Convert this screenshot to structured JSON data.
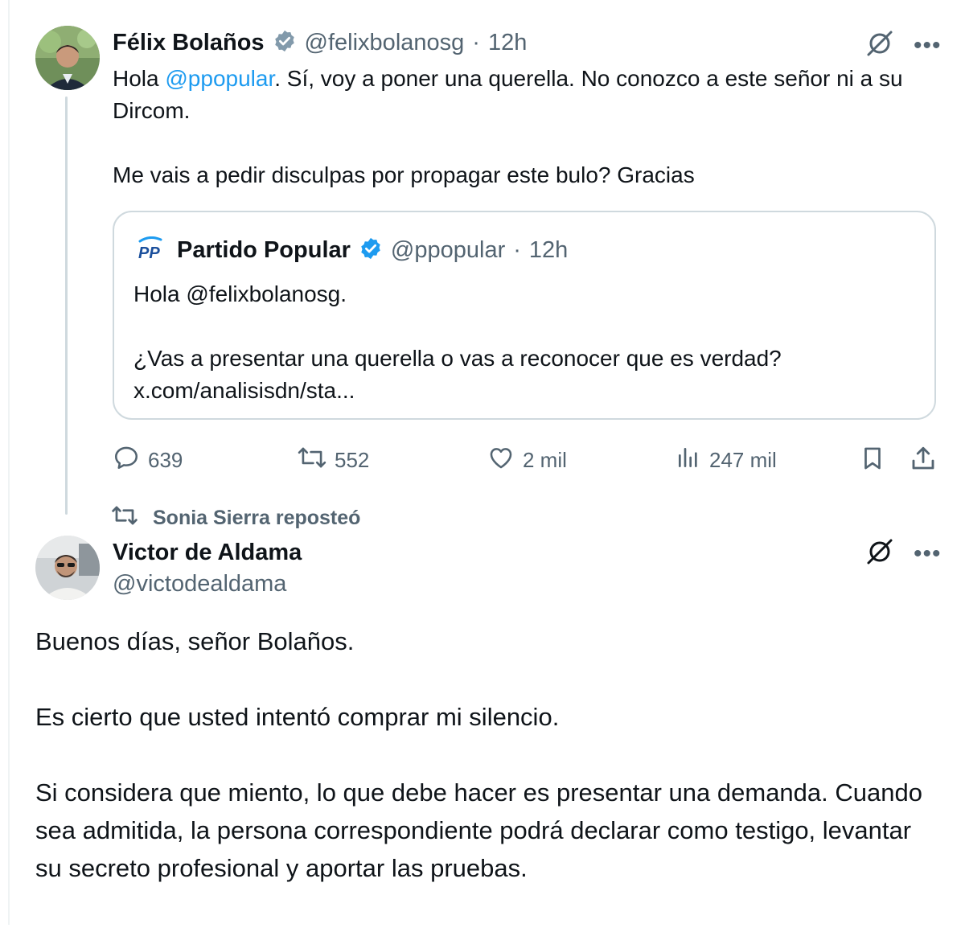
{
  "tweet1": {
    "author_name": "Félix Bolaños",
    "author_handle": "@felixbolanosg",
    "separator": "·",
    "time": "12h",
    "text_part1": "Hola ",
    "mention": "@ppopular",
    "text_part2": ". Sí, voy a poner una querella. No conozco a este señor ni a su Dircom.\n\nMe vais a pedir disculpas por propagar este bulo? Gracias",
    "quoted": {
      "author_name": "Partido Popular",
      "author_handle": "@ppopular",
      "time": "12h",
      "text": "Hola @felixbolanosg.\n\n¿Vas a presentar una querella o vas a reconocer que es verdad?\nx.com/analisisdn/sta..."
    },
    "stats": {
      "replies": "639",
      "reposts": "552",
      "likes": "2 mil",
      "views": "247 mil"
    }
  },
  "repost_label": "Sonia Sierra reposteó",
  "tweet2": {
    "author_name": "Victor de Aldama",
    "author_handle": "@victodealdama",
    "text": "Buenos días, señor Bolaños.\n\nEs cierto que usted intentó comprar mi silencio.\n\nSi considera que miento, lo que debe hacer es presentar una demanda. Cuando sea admitida, la persona correspondiente podrá declarar como testigo, levantar su secreto profesional y aportar las pruebas."
  },
  "icons": {
    "more": "more-icon",
    "grok": "grok-icon",
    "reply": "reply-icon",
    "repost": "repost-icon",
    "like": "like-icon",
    "views": "views-icon",
    "bookmark": "bookmark-icon",
    "share": "share-icon",
    "verified": "verified-badge-icon",
    "pp_logo": "pp-logo-icon"
  },
  "colors": {
    "text": "#0f1419",
    "secondary": "#536471",
    "accent": "#1d9bf0",
    "border": "#cfd9de"
  }
}
